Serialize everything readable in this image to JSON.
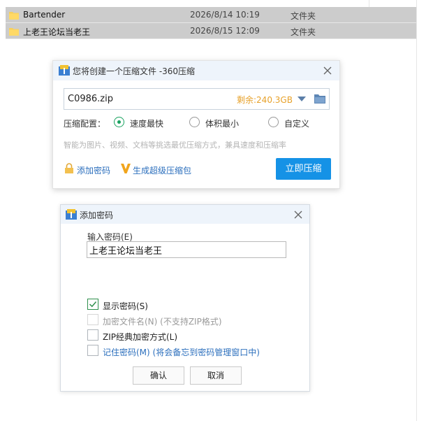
{
  "file_list": {
    "rows": [
      {
        "name": "Bartender",
        "date": "2026/8/14 10:19",
        "type": "文件夹"
      },
      {
        "name": "上老王论坛当老王",
        "date": "2026/8/15 12:09",
        "type": "文件夹"
      }
    ]
  },
  "compress_dialog": {
    "title": "您将创建一个压缩文件 -360压缩",
    "filename": "C0986.zip",
    "free_space": "剩余:240.3GB",
    "config_label": "压缩配置：",
    "options": [
      {
        "label": "速度最快",
        "selected": true
      },
      {
        "label": "体积最小",
        "selected": false
      },
      {
        "label": "自定义",
        "selected": false
      }
    ],
    "hint": "智能为图片、视频、文档等挑选最优压缩方式，兼具速度和压缩率",
    "add_password": "添加密码",
    "super_zip": "生成超级压缩包",
    "compress_button": "立即压缩",
    "colors": {
      "accent": "#1592e6",
      "space": "#e7a12a",
      "link": "#2c6fbd",
      "radio": "#1aa260"
    }
  },
  "password_dialog": {
    "title": "添加密码",
    "input_label": "输入密码(E)",
    "password_value": "上老王论坛当老王",
    "checkboxes": [
      {
        "label": "显示密码(S)",
        "checked": true,
        "disabled": false
      },
      {
        "label": "加密文件名(N) (不支持ZIP格式)",
        "checked": false,
        "disabled": true
      },
      {
        "label": "ZIP经典加密方式(L)",
        "checked": false,
        "disabled": false
      },
      {
        "label": "记住密码(M) (将会备忘到密码管理窗口中)",
        "checked": false,
        "disabled": false
      }
    ],
    "ok_button": "确认",
    "cancel_button": "取消"
  }
}
